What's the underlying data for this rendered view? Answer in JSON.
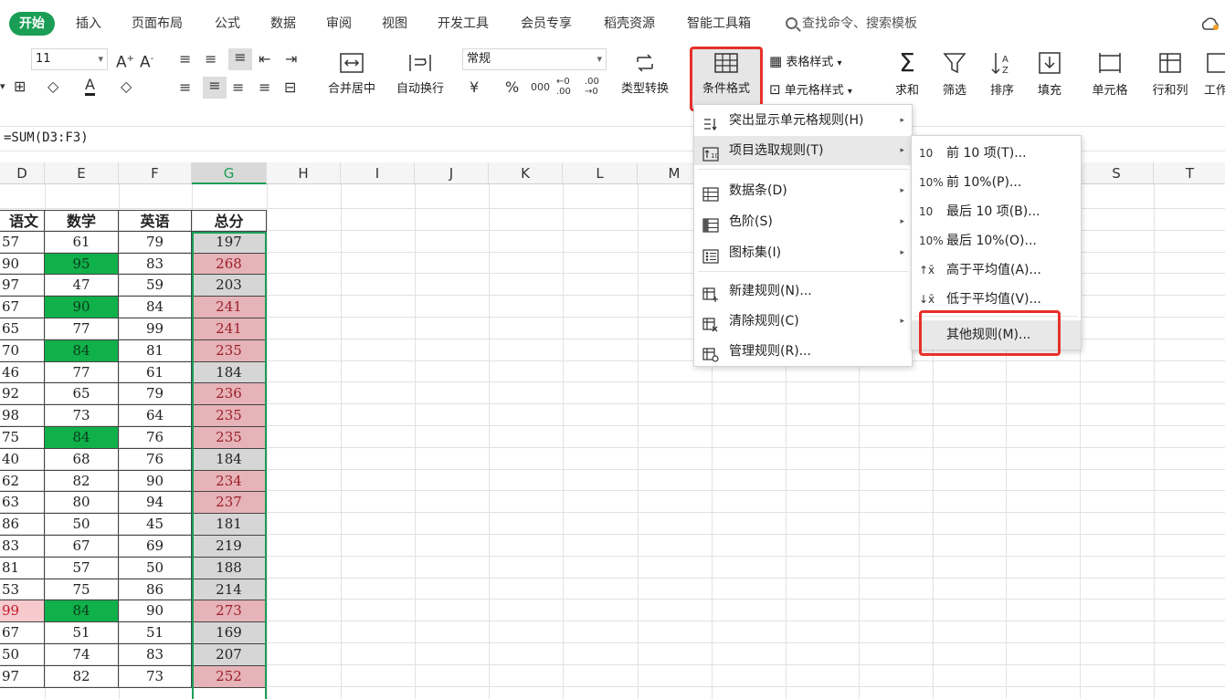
{
  "menubar": {
    "tabs": [
      "开始",
      "插入",
      "页面布局",
      "公式",
      "数据",
      "审阅",
      "视图",
      "开发工具",
      "会员专享",
      "稻壳资源",
      "智能工具箱"
    ],
    "search_placeholder": "查找命令、搜索模板"
  },
  "ribbon": {
    "font_size": "11",
    "number_format": "常规",
    "merge_center": "合并居中",
    "wrap_text": "自动换行",
    "type_convert": "类型转换",
    "conditional_format": "条件格式",
    "table_style": "表格样式",
    "cell_style": "单元格样式",
    "sum": "求和",
    "filter": "筛选",
    "sort": "排序",
    "fill": "填充",
    "cell": "单元格",
    "row_col": "行和列",
    "worksheet": "工作"
  },
  "formula_bar": {
    "text": "=SUM(D3:F3)"
  },
  "sheet": {
    "columns": [
      "D",
      "E",
      "F",
      "G",
      "H",
      "I",
      "J",
      "K",
      "L",
      "M",
      "S",
      "T"
    ],
    "headers": [
      "语文",
      "数学",
      "英语",
      "总分"
    ],
    "rows": [
      [
        57,
        61,
        79,
        197
      ],
      [
        90,
        95,
        83,
        268
      ],
      [
        97,
        47,
        59,
        203
      ],
      [
        67,
        90,
        84,
        241
      ],
      [
        65,
        77,
        99,
        241
      ],
      [
        70,
        84,
        81,
        235
      ],
      [
        46,
        77,
        61,
        184
      ],
      [
        92,
        65,
        79,
        236
      ],
      [
        98,
        73,
        64,
        235
      ],
      [
        75,
        84,
        76,
        235
      ],
      [
        40,
        68,
        76,
        184
      ],
      [
        62,
        82,
        90,
        234
      ],
      [
        63,
        80,
        94,
        237
      ],
      [
        86,
        50,
        45,
        181
      ],
      [
        83,
        67,
        69,
        219
      ],
      [
        81,
        57,
        50,
        188
      ],
      [
        53,
        75,
        86,
        214
      ],
      [
        99,
        84,
        90,
        273
      ],
      [
        67,
        51,
        51,
        169
      ],
      [
        50,
        74,
        83,
        207
      ],
      [
        97,
        82,
        73,
        252
      ]
    ],
    "highlight_colors": {
      "top_green": "#10b04a",
      "total_pink": "#e6b3b8",
      "total_gray": "#d6d6d6"
    }
  },
  "cond_menu": {
    "items": [
      {
        "label": "突出显示单元格规则(H)",
        "icon": "highlight-rules-icon",
        "submenu": true
      },
      {
        "label": "项目选取规则(T)",
        "icon": "top-bottom-rules-icon",
        "submenu": true
      },
      {
        "label": "数据条(D)",
        "icon": "data-bars-icon",
        "submenu": true
      },
      {
        "label": "色阶(S)",
        "icon": "color-scales-icon",
        "submenu": true
      },
      {
        "label": "图标集(I)",
        "icon": "icon-sets-icon",
        "submenu": true
      },
      {
        "label": "新建规则(N)...",
        "icon": "new-rule-icon",
        "submenu": false
      },
      {
        "label": "清除规则(C)",
        "icon": "clear-rules-icon",
        "submenu": true
      },
      {
        "label": "管理规则(R)...",
        "icon": "manage-rules-icon",
        "submenu": false
      }
    ]
  },
  "sub_menu": {
    "items": [
      {
        "label": "前 10 项(T)...",
        "icon": "top-10-icon",
        "glyph": "10"
      },
      {
        "label": "前 10%(P)...",
        "icon": "top-10-percent-icon",
        "glyph": "10%"
      },
      {
        "label": "最后 10 项(B)...",
        "icon": "bottom-10-icon",
        "glyph": "10"
      },
      {
        "label": "最后 10%(O)...",
        "icon": "bottom-10-percent-icon",
        "glyph": "10%"
      },
      {
        "label": "高于平均值(A)...",
        "icon": "above-average-icon",
        "glyph": "↑x̄"
      },
      {
        "label": "低于平均值(V)...",
        "icon": "below-average-icon",
        "glyph": "↓x̄"
      },
      {
        "label": "其他规则(M)...",
        "icon": "",
        "glyph": ""
      }
    ]
  }
}
